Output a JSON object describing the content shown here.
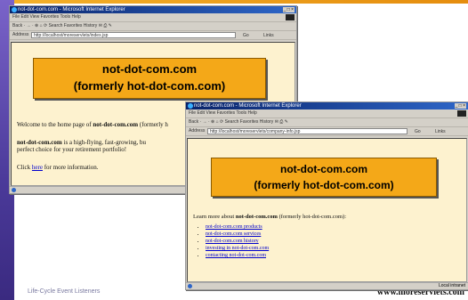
{
  "slide": {
    "footer_left": "Life-Cycle Event Listeners",
    "footer_right": "www.moreservlets.com"
  },
  "window1": {
    "title": "not-dot-com.com - Microsoft Internet Explorer",
    "menu": "File   Edit   View   Favorites   Tools   Help",
    "toolbar": "Back  ·  →  ·  ⊗  ⌂  ⟳   Search   Favorites   History   ✉  ⎙  ✎",
    "address_label": "Address",
    "address_value": "http://localhost/moreservlets/index.jsp",
    "go": "Go",
    "links_label": "Links",
    "controls": "_ □ ×",
    "banner_line1": "not-dot-com.com",
    "banner_line2": "(formerly hot-dot-com.com)",
    "welcome_prefix": "Welcome to the home page of ",
    "welcome_name": "not-dot-com.com",
    "welcome_suffix": " (formerly h",
    "para2_name": "not-dot-com.com",
    "para2_text": " is a high-flying, fast-growing, bu",
    "para2_line2": "perfect choice for your retirement portfolio!",
    "click_prefix": "Click ",
    "click_link": "here",
    "click_suffix": " for more information."
  },
  "window2": {
    "title": "not-dot-com.com - Microsoft Internet Explorer",
    "menu": "File   Edit   View   Favorites   Tools   Help",
    "toolbar": "Back  ·  →  ·  ⊗  ⌂  ⟳   Search   Favorites   History   ✉  ⎙  ✎",
    "address_label": "Address",
    "address_value": "http://localhost/moreservlets/company-info.jsp",
    "go": "Go",
    "links_label": "Links",
    "controls": "_ □ ×",
    "banner_line1": "not-dot-com.com",
    "banner_line2": "(formerly hot-dot-com.com)",
    "learn_prefix": "Learn more about ",
    "learn_name": "not-dot-com.com",
    "learn_suffix": " (formerly hot-dot-com.com):",
    "links": [
      "not-dot-com.com products",
      "not-dot-com.com services",
      "not-dot-com.com history",
      "investing in not-dot-com.com",
      "contacting not-dot-com.com"
    ],
    "status_zone": "Local intranet"
  }
}
